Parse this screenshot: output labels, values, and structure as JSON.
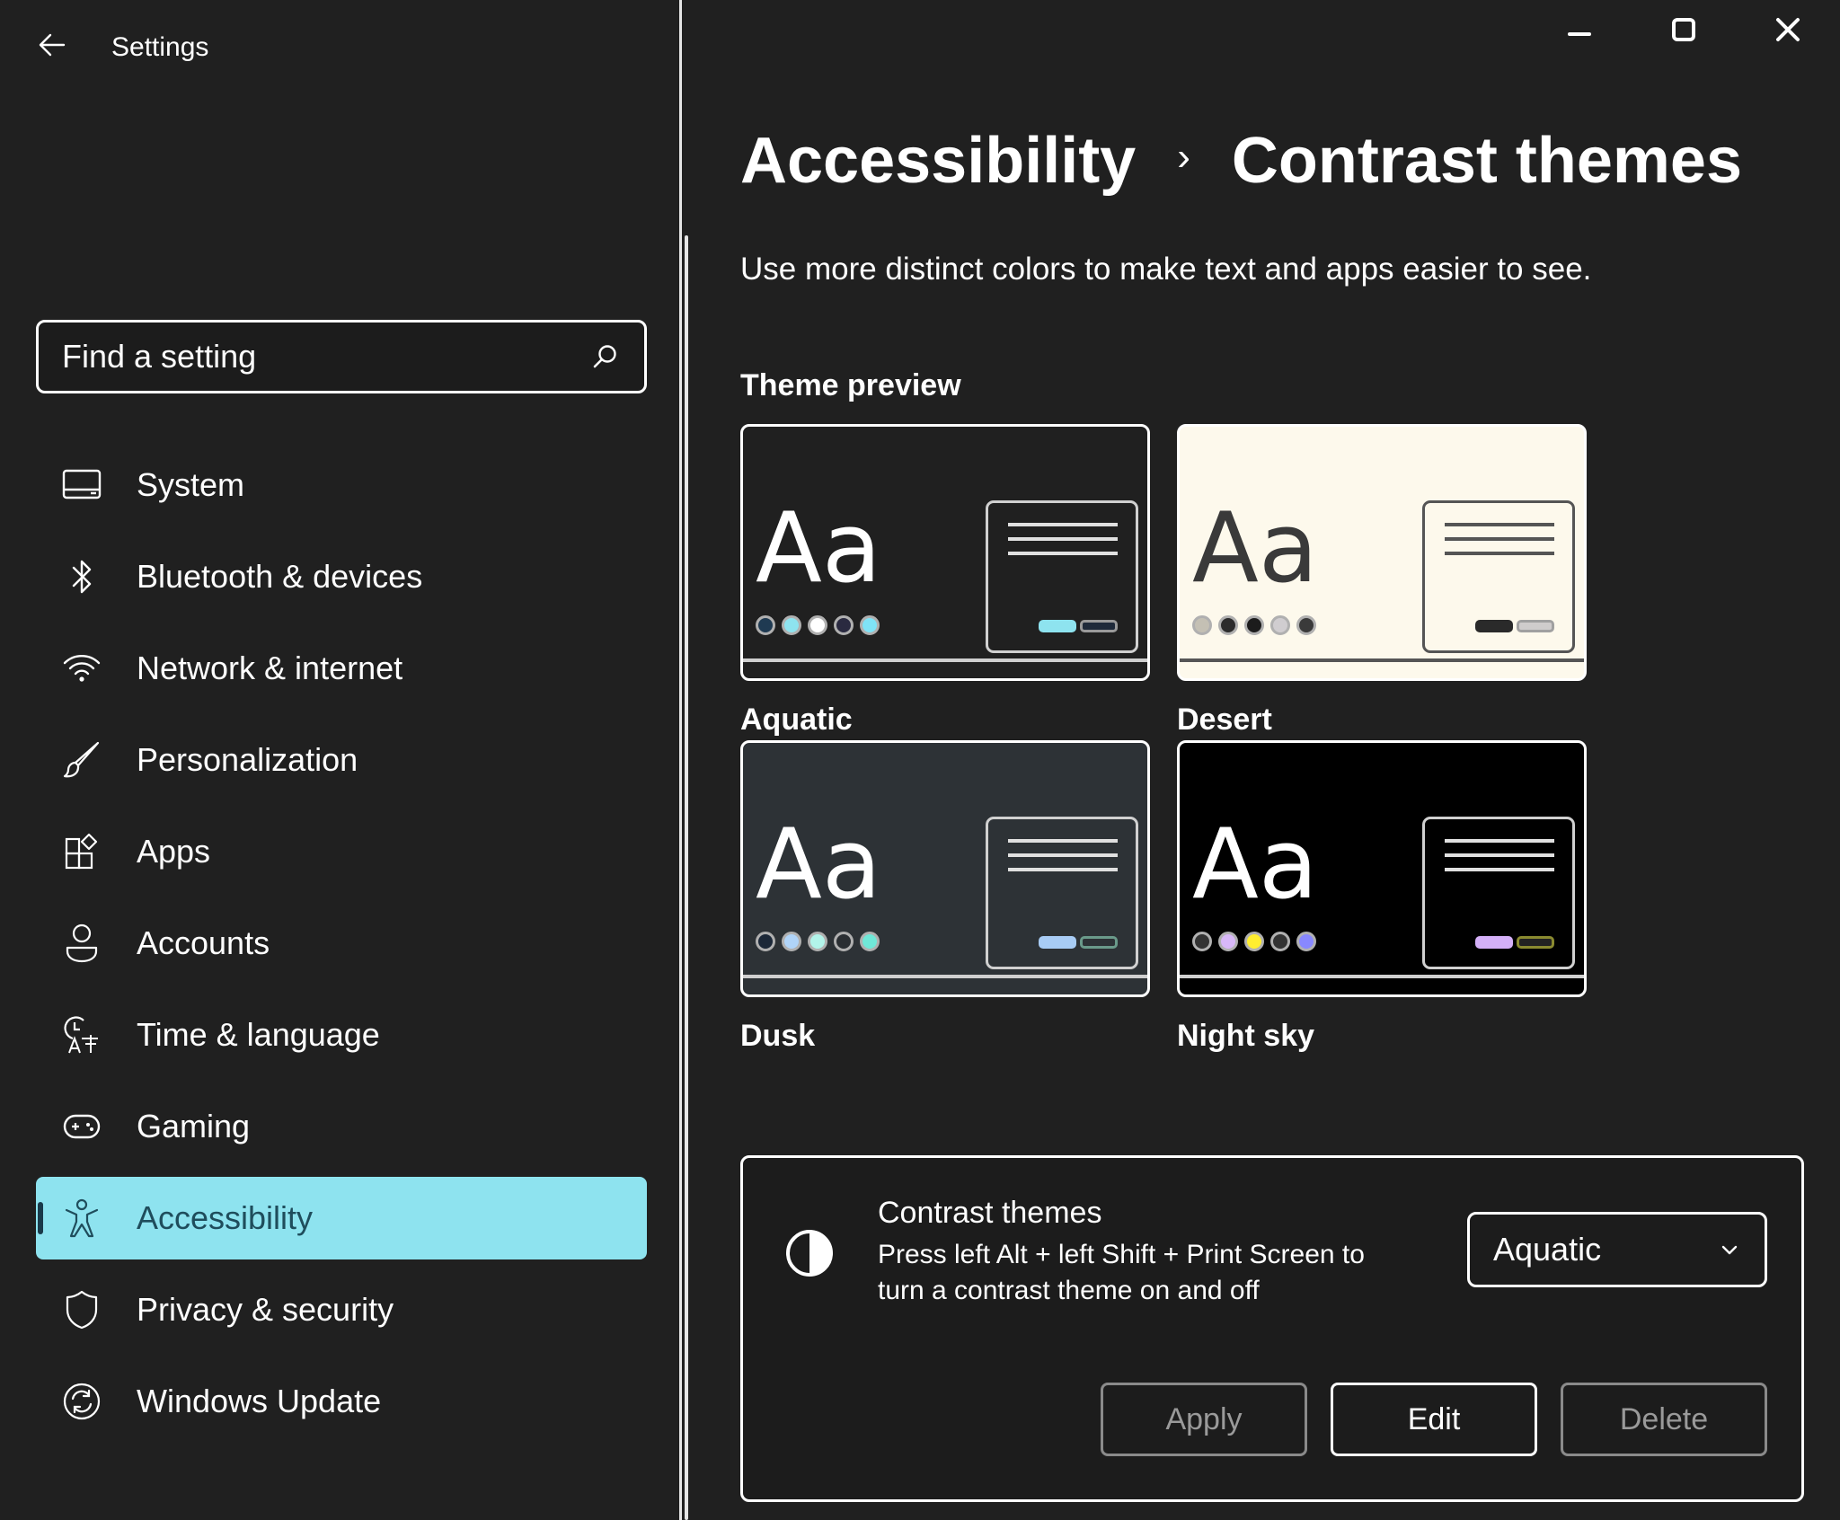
{
  "app": {
    "title": "Settings"
  },
  "window_controls": {
    "minimize": "minimize-icon",
    "maximize": "maximize-icon",
    "close": "close-icon"
  },
  "search": {
    "placeholder": "Find a setting",
    "value": "",
    "icon": "search-icon"
  },
  "sidebar": {
    "items": [
      {
        "label": "System",
        "icon": "system-icon",
        "active": false
      },
      {
        "label": "Bluetooth & devices",
        "icon": "bluetooth-icon",
        "active": false
      },
      {
        "label": "Network & internet",
        "icon": "wifi-icon",
        "active": false
      },
      {
        "label": "Personalization",
        "icon": "brush-icon",
        "active": false
      },
      {
        "label": "Apps",
        "icon": "apps-icon",
        "active": false
      },
      {
        "label": "Accounts",
        "icon": "person-icon",
        "active": false
      },
      {
        "label": "Time & language",
        "icon": "time-language-icon",
        "active": false
      },
      {
        "label": "Gaming",
        "icon": "gamepad-icon",
        "active": false
      },
      {
        "label": "Accessibility",
        "icon": "accessibility-icon",
        "active": true
      },
      {
        "label": "Privacy & security",
        "icon": "shield-icon",
        "active": false
      },
      {
        "label": "Windows Update",
        "icon": "update-icon",
        "active": false
      }
    ],
    "active_color": "#8ee3ef"
  },
  "main": {
    "breadcrumb": {
      "parent": "Accessibility",
      "separator": "›",
      "current": "Contrast themes"
    },
    "description": "Use more distinct colors to make text and apps easier to see.",
    "preview_title": "Theme preview",
    "themes": [
      {
        "name": "Aquatic",
        "sample": "Aa",
        "bg": "#202020",
        "text": "#ffffff",
        "lines": "#e0e0e0",
        "window_border": "#d0d0d0",
        "dots": [
          "#1f3a52",
          "#8ee3ef",
          "#ffffff",
          "#2a2a40",
          "#7fe3f7"
        ],
        "button1": "#8ee3ef",
        "button2_fill": "#1f2a3a",
        "button2_border": "#9a9a9a",
        "bar": "#cfcfcf"
      },
      {
        "name": "Desert",
        "sample": "Aa",
        "bg": "#fdf9ec",
        "text": "#3a3a3a",
        "lines": "#555555",
        "window_border": "#555555",
        "dots": [
          "#c4c0b4",
          "#2c2c2c",
          "#1c1c1c",
          "#d0cdd0",
          "#3a3a3a"
        ],
        "button1": "#2a2a2a",
        "button2_fill": "#cfcccc",
        "button2_border": "#a0a0a0",
        "bar": "#555555"
      },
      {
        "name": "Dusk",
        "sample": "Aa",
        "bg": "#2d3236",
        "text": "#ffffff",
        "lines": "#e0e0e0",
        "window_border": "#d0d0d0",
        "dots": [
          "#1c2838",
          "#b0d4f8",
          "#b2f4ea",
          "#2a2e32",
          "#70e8d8"
        ],
        "button1": "#a8ccf5",
        "button2_fill": "#2d3236",
        "button2_border": "#6a9a8a",
        "bar": "#cfcfcf"
      },
      {
        "name": "Night sky",
        "sample": "Aa",
        "bg": "#000000",
        "text": "#ffffff",
        "lines": "#e0e0e0",
        "window_border": "#d0d0d0",
        "dots": [
          "#333333",
          "#d8b8f8",
          "#ffee30",
          "#333333",
          "#8888ff"
        ],
        "button1": "#d4b0f8",
        "button2_fill": "#222222",
        "button2_border": "#8a8a30",
        "bar": "#cfcfcf"
      }
    ]
  },
  "contrast_card": {
    "icon": "contrast-icon",
    "title": "Contrast themes",
    "description": "Press left Alt + left Shift + Print Screen to turn a contrast theme on and off",
    "select": {
      "value": "Aquatic",
      "icon": "chevron-down-icon"
    },
    "buttons": [
      {
        "label": "Apply",
        "enabled": false
      },
      {
        "label": "Edit",
        "enabled": true
      },
      {
        "label": "Delete",
        "enabled": false
      }
    ]
  }
}
